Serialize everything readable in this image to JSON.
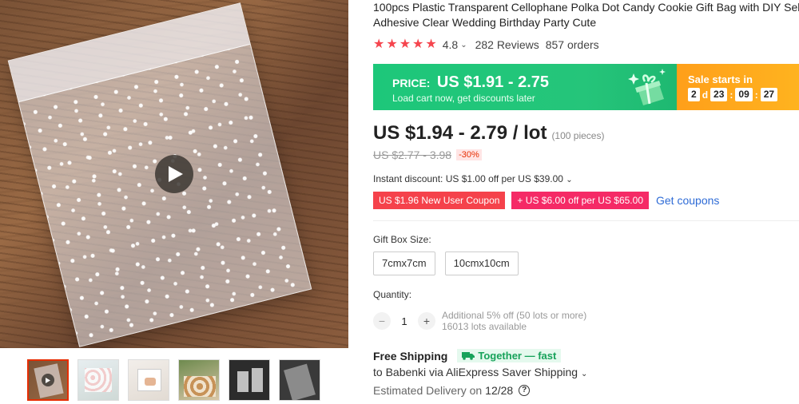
{
  "product": {
    "title": "100pcs Plastic Transparent Cellophane Polka Dot Candy Cookie Gift Bag with DIY Self Adhesive Clear Wedding Birthday Party Cute",
    "rating": "4.8",
    "rating_stars": 5,
    "reviews": "282 Reviews",
    "orders": "857 orders"
  },
  "media": {
    "main_image_icon": "play-icon",
    "thumbnails": [
      {
        "name": "video"
      },
      {
        "name": "bags-pink"
      },
      {
        "name": "bag-box"
      },
      {
        "name": "cookies-bags"
      },
      {
        "name": "bags-dark"
      },
      {
        "name": "bag-dark-angled"
      }
    ]
  },
  "banner": {
    "price_label": "PRICE:",
    "price_range": "US $1.91 - 2.75",
    "subtitle": "Load cart now, get discounts later",
    "sale_label": "Sale starts in",
    "countdown": {
      "days": "2",
      "days_label": "d",
      "hours": "23",
      "minutes": "09",
      "seconds": "27"
    },
    "green_color": "#25c57a",
    "orange_color": "#ffa91d"
  },
  "pricing": {
    "current": "US $1.94 - 2.79 / lot",
    "pieces": "(100 pieces)",
    "original": "US $2.77 - 3.98",
    "discount": "-30%",
    "instant_discount": "Instant discount: US $1.00 off per US $39.00",
    "coupon_new_user": "US $1.96 New User Coupon",
    "coupon_store": "US $6.00 off per US $65.00",
    "coupon_store_prefix": "+",
    "get_coupons": "Get coupons"
  },
  "options": {
    "size_label": "Gift Box Size:",
    "sizes": [
      "7cmx7cm",
      "10cmx10cm"
    ]
  },
  "quantity": {
    "label": "Quantity:",
    "value": "1",
    "minus": "−",
    "plus": "+",
    "note_line1": "Additional 5% off (50 lots or more)",
    "note_line2": "16013 lots available"
  },
  "shipping": {
    "free_shipping": "Free Shipping",
    "together_label": "Together — fast",
    "ship_to": "to Babenki via AliExpress Saver Shipping",
    "delivery_label": "Estimated Delivery on",
    "delivery_date": "12/28",
    "help_glyph": "?"
  }
}
